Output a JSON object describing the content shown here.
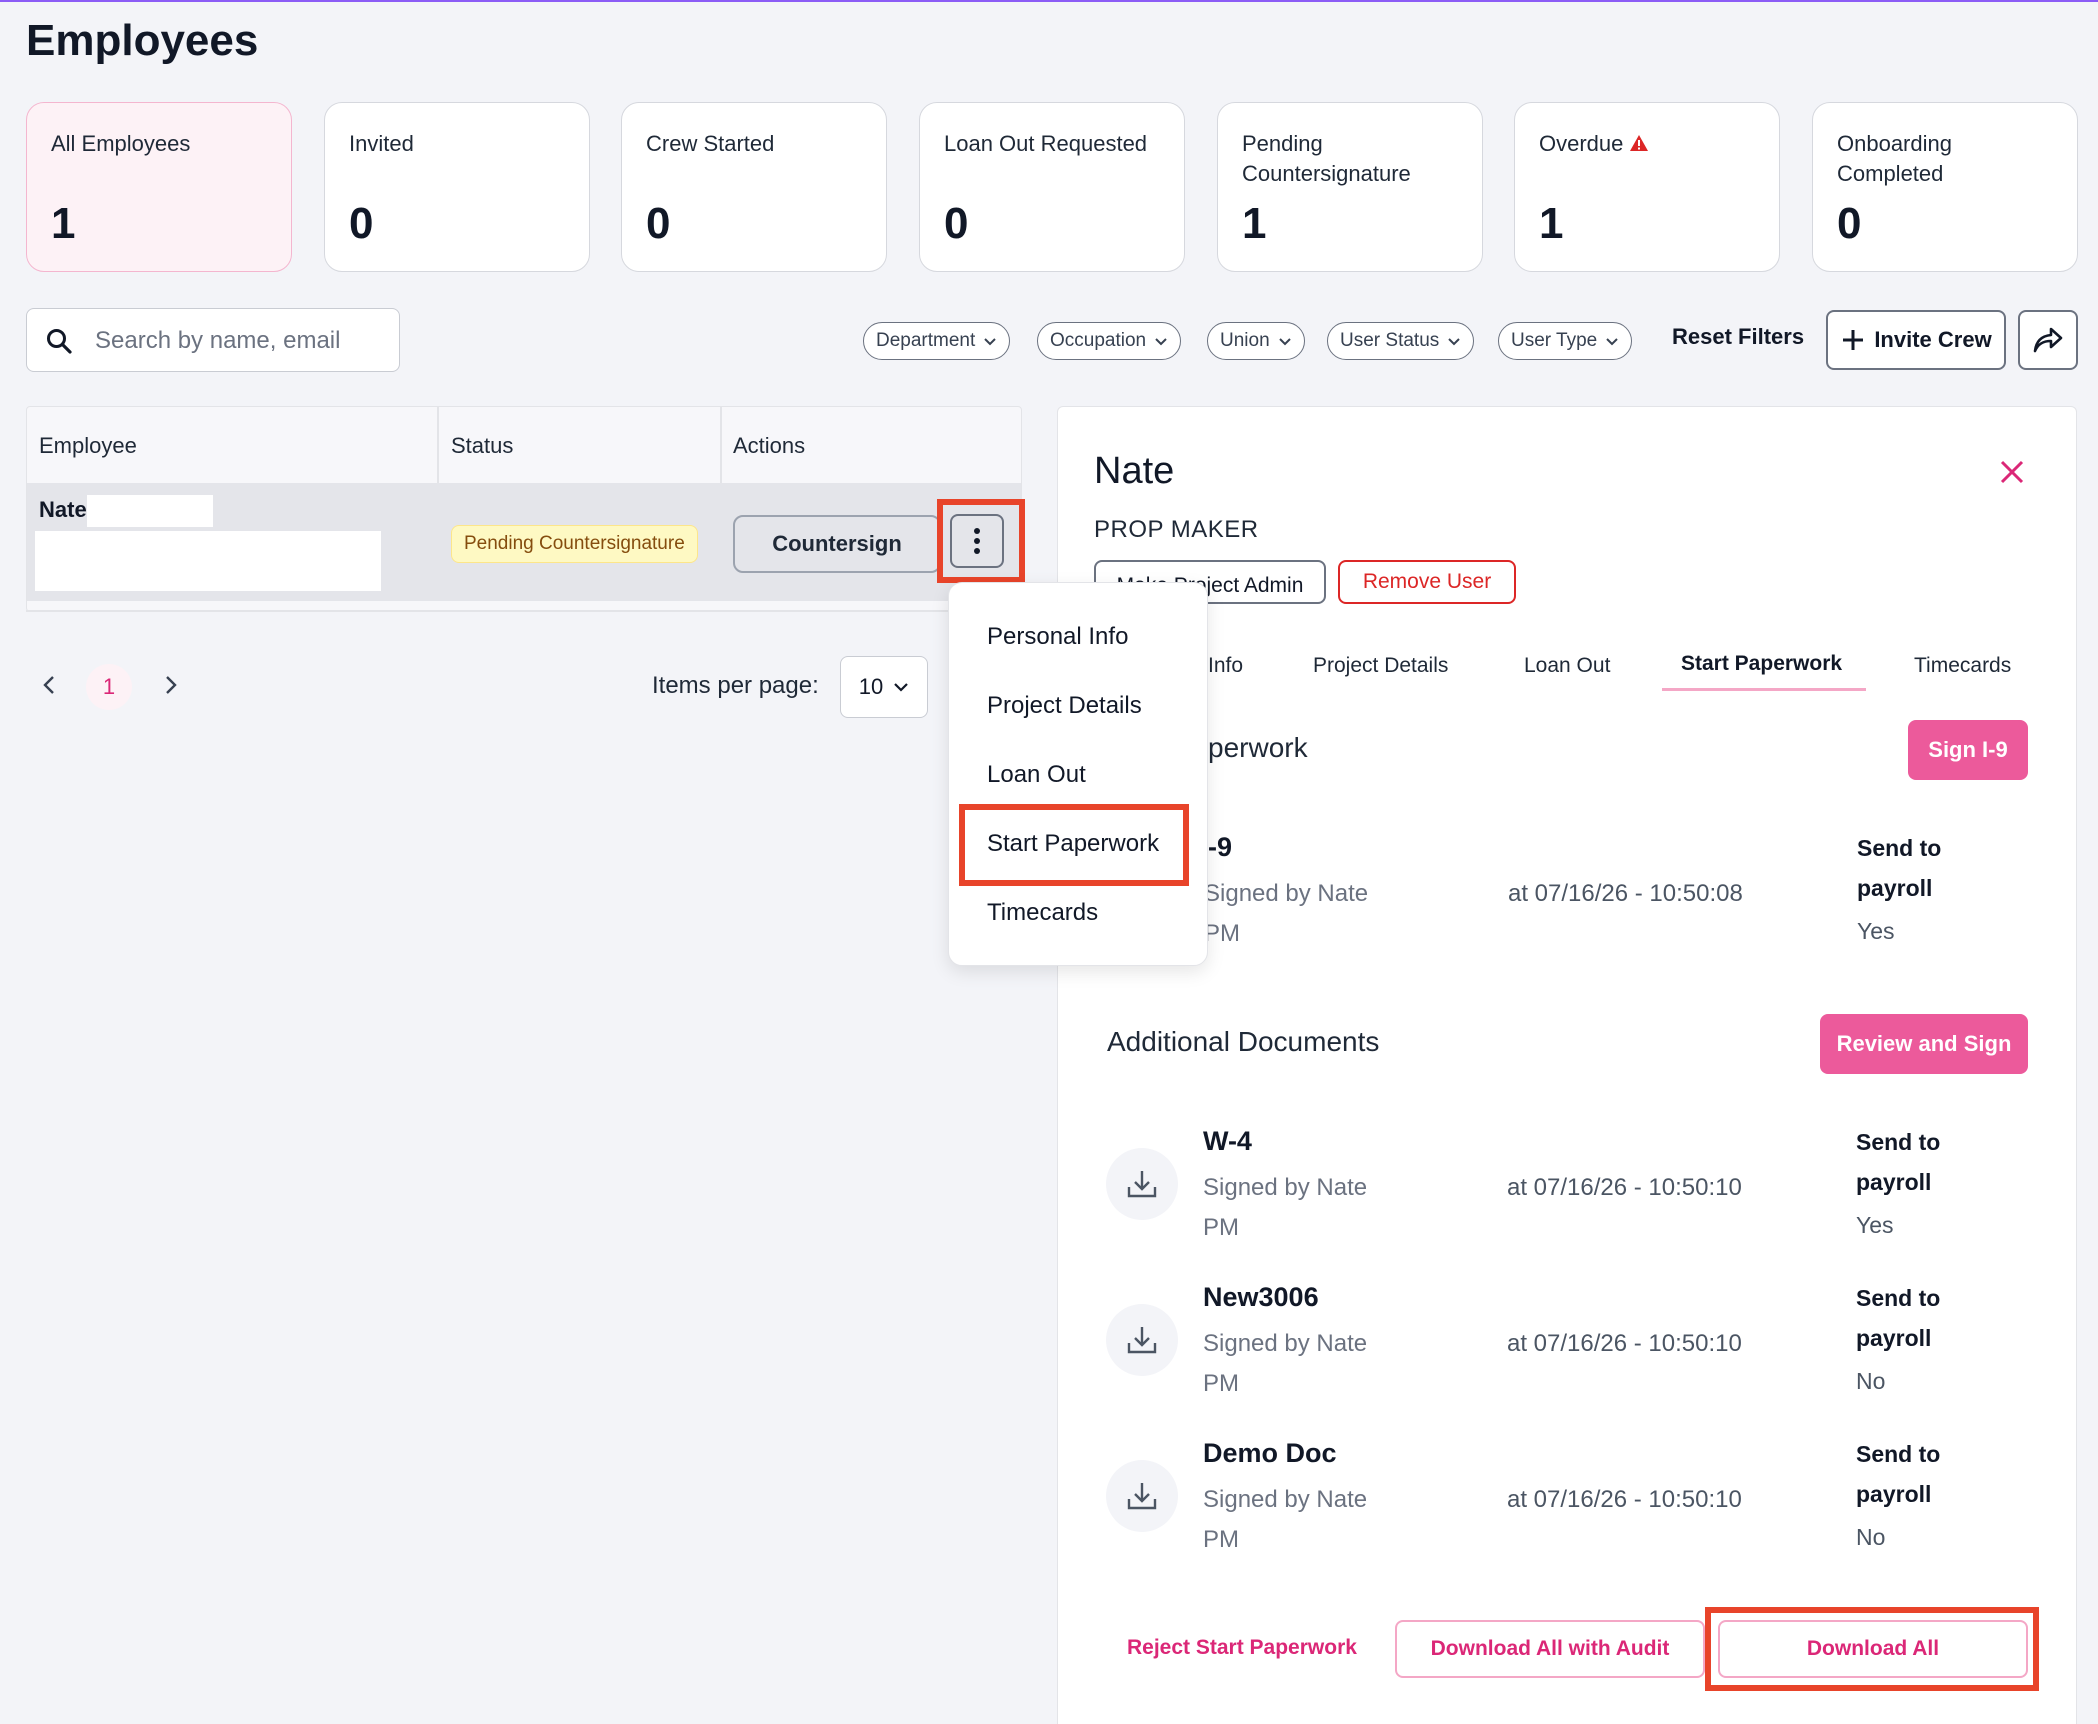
{
  "page": {
    "title": "Employees"
  },
  "stats": [
    {
      "label": "All Employees",
      "value": "1"
    },
    {
      "label": "Invited",
      "value": "0"
    },
    {
      "label": "Crew Started",
      "value": "0"
    },
    {
      "label": "Loan Out Requested",
      "value": "0"
    },
    {
      "label": "Pending Countersignature",
      "value": "1"
    },
    {
      "label": "Overdue",
      "value": "1",
      "icon": "warning-icon"
    },
    {
      "label": "Onboarding Completed",
      "value": "0"
    }
  ],
  "search": {
    "placeholder": "Search by name, email",
    "value": ""
  },
  "filters": [
    "Department",
    "Occupation",
    "Union",
    "User Status",
    "User Type"
  ],
  "toolbar": {
    "reset_label": "Reset Filters",
    "invite_label": "Invite Crew"
  },
  "table": {
    "headers": {
      "employee": "Employee",
      "status": "Status",
      "actions": "Actions"
    },
    "rows": [
      {
        "name": "Nate",
        "status": "Pending Countersignature",
        "action": "Countersign"
      }
    ]
  },
  "pagination": {
    "page": "1",
    "items_per_page_label": "Items per page:",
    "items_per_page": "10"
  },
  "menu": {
    "items": [
      "Personal Info",
      "Project Details",
      "Loan Out",
      "Start Paperwork",
      "Timecards"
    ]
  },
  "panel": {
    "name": "Nate",
    "role": "PROP MAKER",
    "make_admin_label": "Make Project Admin",
    "remove_label": "Remove User",
    "tabs": [
      "Info",
      "Project Details",
      "Loan Out",
      "Start Paperwork",
      "Timecards"
    ],
    "section_title": "perwork",
    "sign_i9_label": "Sign I-9",
    "i9": {
      "title": "-9",
      "signed": "Signed by Nate",
      "time_suffix": "PM",
      "date": "at 07/16/26 - 10:50:08",
      "payroll_label": "Send to payroll",
      "payroll_value": "Yes"
    },
    "additional_title": "Additional Documents",
    "review_sign_label": "Review and Sign",
    "documents": [
      {
        "title": "W-4",
        "signed": "Signed by Nate",
        "time_suffix": "PM",
        "date": "at 07/16/26 - 10:50:10",
        "payroll_label": "Send to payroll",
        "payroll_value": "Yes"
      },
      {
        "title": "New3006",
        "signed": "Signed by Nate",
        "time_suffix": "PM",
        "date": "at 07/16/26 - 10:50:10",
        "payroll_label": "Send to payroll",
        "payroll_value": "No"
      },
      {
        "title": "Demo Doc",
        "signed": "Signed by Nate",
        "time_suffix": "PM",
        "date": "at 07/16/26 - 10:50:10",
        "payroll_label": "Send to payroll",
        "payroll_value": "No"
      }
    ],
    "footer": {
      "reject_label": "Reject Start Paperwork",
      "download_audit_label": "Download All with Audit",
      "download_all_label": "Download All"
    }
  },
  "colors": {
    "accent": "#ec5a9b",
    "highlight": "#e8442a",
    "danger": "#dc2626"
  }
}
